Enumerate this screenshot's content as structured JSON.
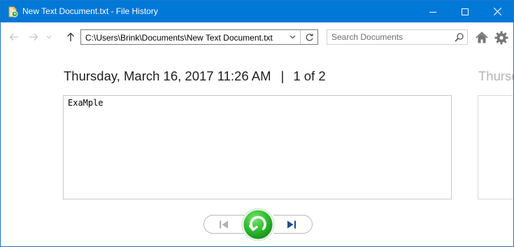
{
  "window": {
    "title": "New Text Document.txt - File History",
    "accent_color": "#0078d7",
    "controls": {
      "minimize": "minimize-icon",
      "maximize": "maximize-icon",
      "close": "close-icon"
    }
  },
  "toolbar": {
    "back": "arrow-left-icon",
    "forward": "arrow-right-icon",
    "recent": "chevron-down-icon",
    "up": "arrow-up-icon",
    "address": {
      "path": "C:\\Users\\Brink\\Documents\\New Text Document.txt",
      "dropdown": "chevron-down-icon",
      "refresh": "refresh-icon"
    },
    "search": {
      "placeholder": "Search Documents",
      "value": "",
      "icon": "search-icon"
    },
    "home": "home-icon",
    "settings": "gear-icon"
  },
  "version": {
    "datetime": "Thursday, March 16, 2017 11:26 AM",
    "separator": "|",
    "position": "1 of 2",
    "next_datetime_partial": "Thursd"
  },
  "preview": {
    "content": "ExaMple"
  },
  "controls": {
    "previous": "skip-previous-icon",
    "restore": "restore-icon",
    "restore_color": "#2ebd2e",
    "next": "skip-next-icon"
  }
}
